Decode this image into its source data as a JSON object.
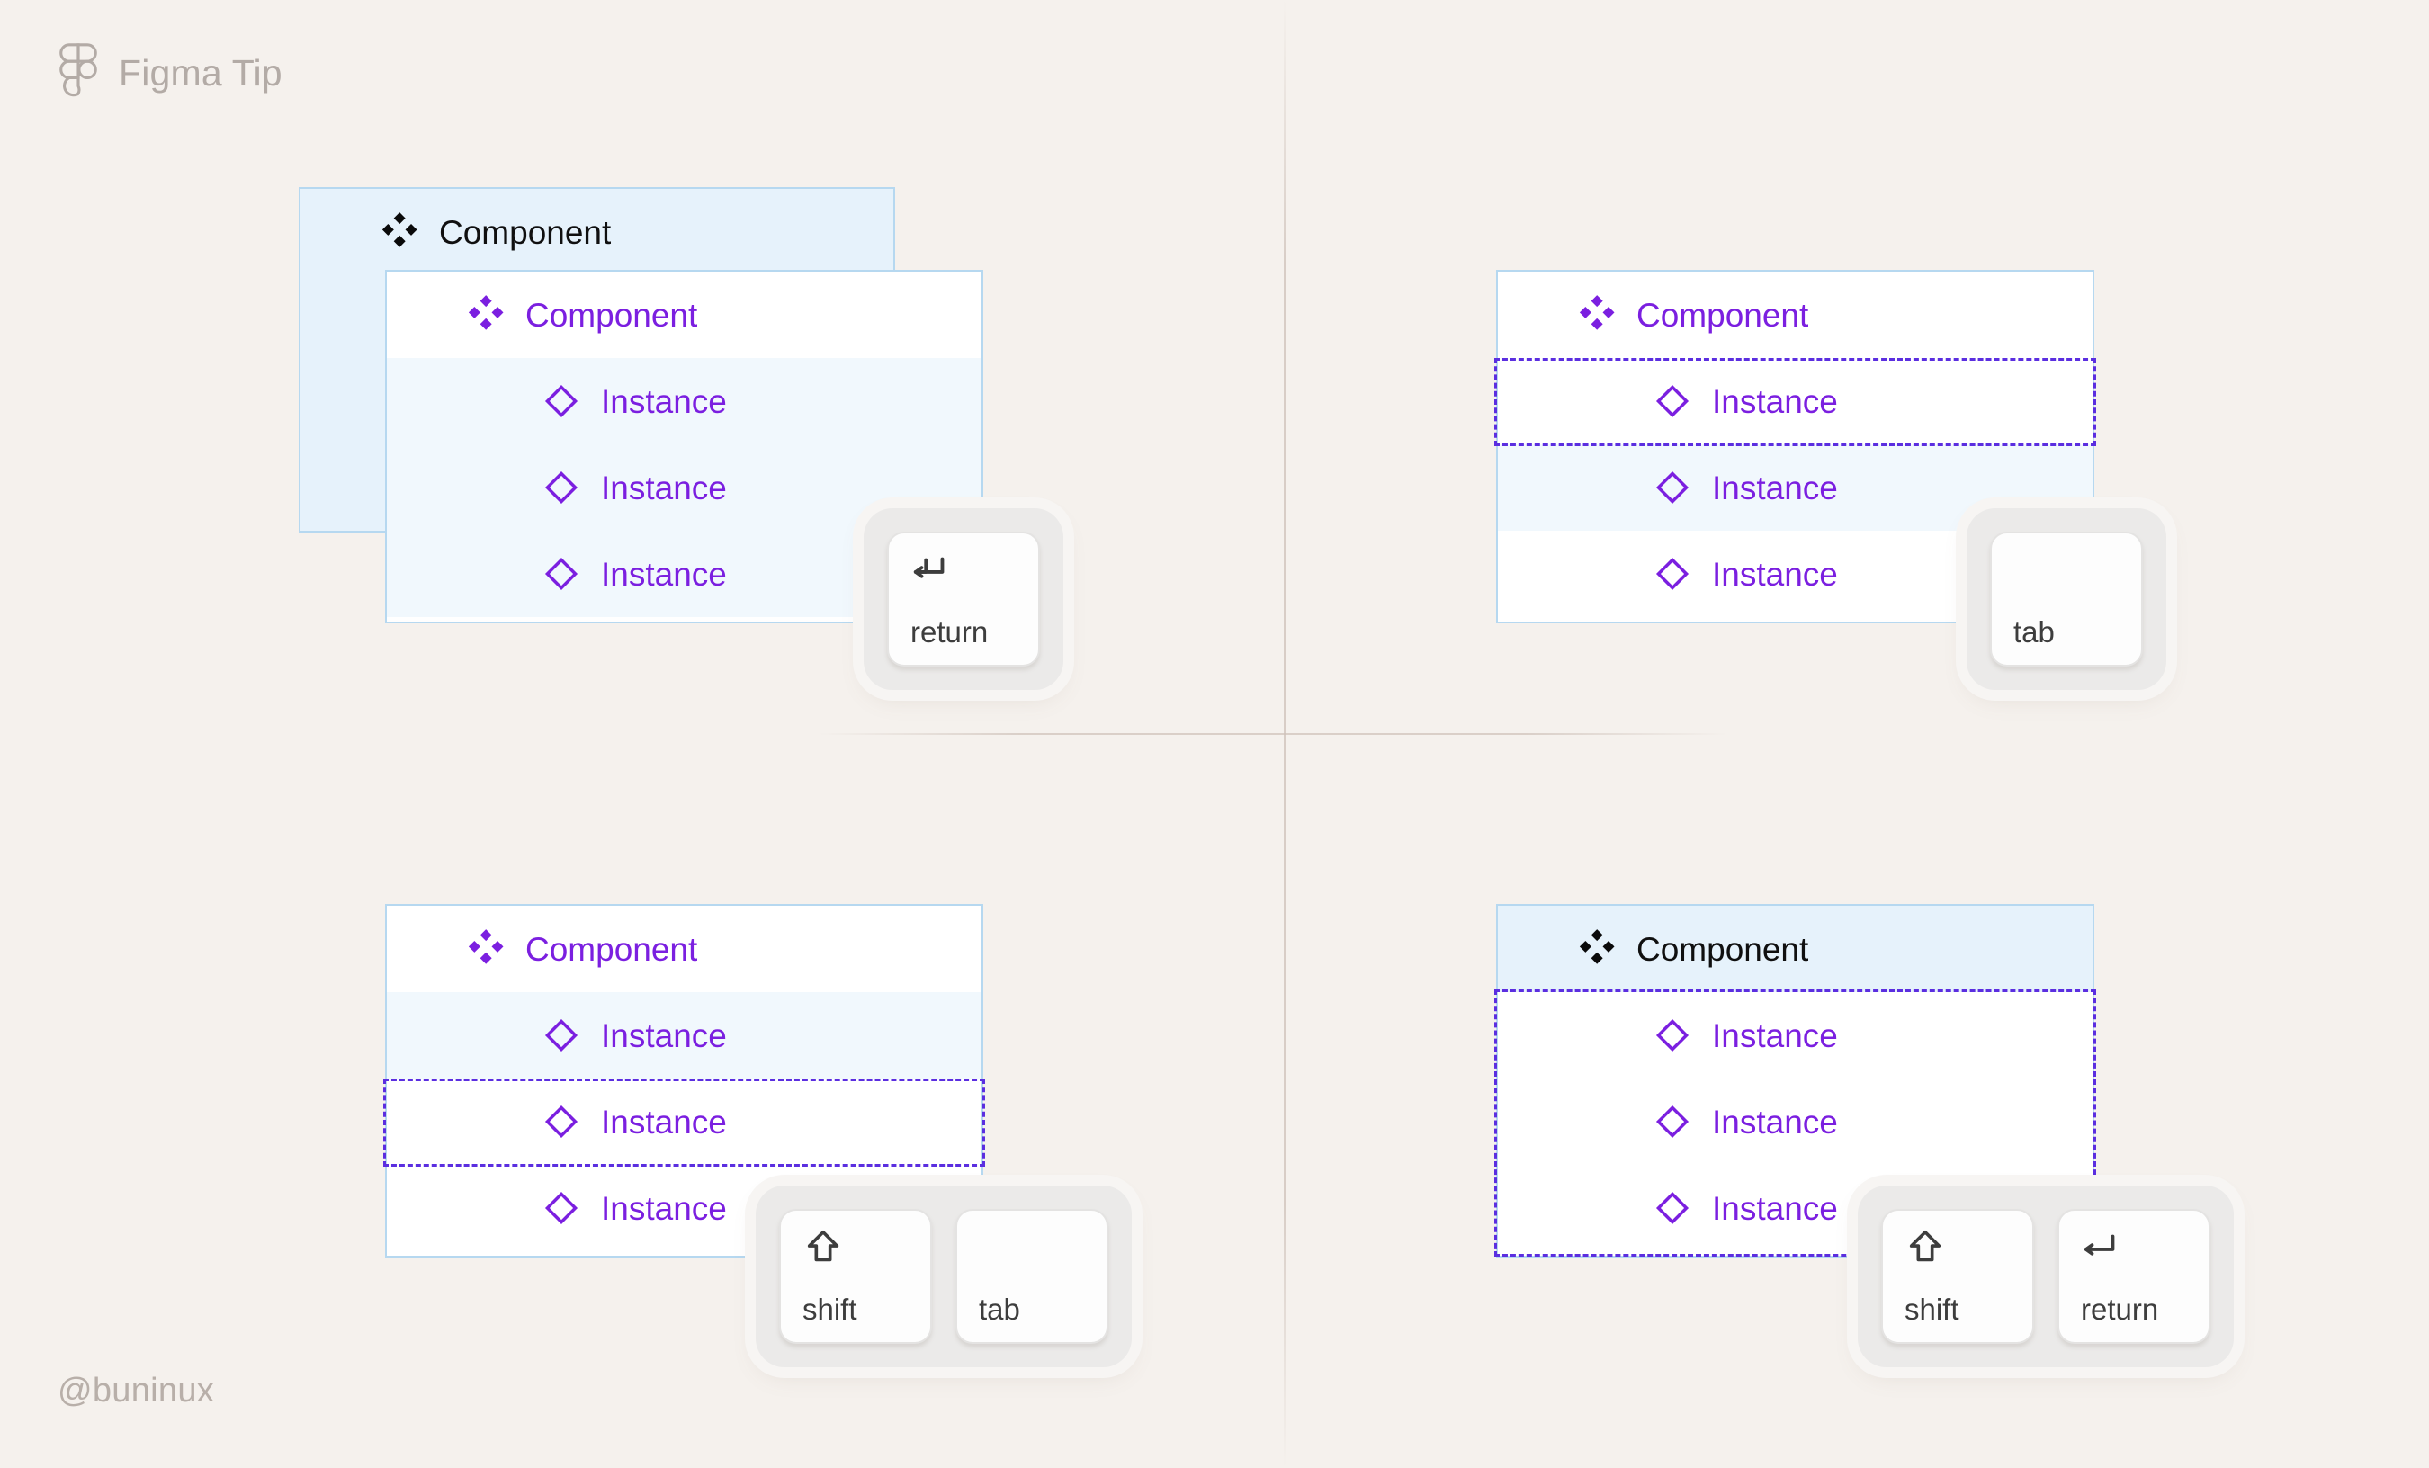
{
  "header": {
    "title": "Figma Tip",
    "logo_icon": "figma-logo-icon"
  },
  "watermark": "@buninux",
  "icons": {
    "component": "component-diamond-icon",
    "instance": "instance-diamond-outline-icon",
    "shift": "shift-arrow-up-icon",
    "return": "return-arrow-icon"
  },
  "colors": {
    "background": "#F5F1ED",
    "card_border": "#B6D8F0",
    "selection": "#5B2EE0",
    "purple_text": "#7B1FE0",
    "row_highlight": "#E6F2FB",
    "row_highlight_soft": "#F1F8FD",
    "header_text": "#B3ABA6"
  },
  "panels": [
    {
      "id": "top-left",
      "shortcut_label": "return",
      "ghost_card": {
        "label": "Component",
        "icon": "component-diamond-icon"
      },
      "rows": [
        {
          "label": "Component",
          "type": "component",
          "tone": "black",
          "fill": "white"
        },
        {
          "label": "Instance",
          "type": "instance",
          "tone": "purple",
          "fill": "lightblue"
        },
        {
          "label": "Instance",
          "type": "instance",
          "tone": "purple",
          "fill": "lightblue"
        },
        {
          "label": "Instance",
          "type": "instance",
          "tone": "purple",
          "fill": "lightblue"
        }
      ]
    },
    {
      "id": "top-right",
      "shortcut_label": "tab",
      "rows": [
        {
          "label": "Component",
          "type": "component",
          "tone": "purple",
          "fill": "white"
        },
        {
          "label": "Instance",
          "type": "instance",
          "tone": "purple",
          "fill": "white",
          "selected": true
        },
        {
          "label": "Instance",
          "type": "instance",
          "tone": "purple",
          "fill": "lightblue"
        },
        {
          "label": "Instance",
          "type": "instance",
          "tone": "purple",
          "fill": "white"
        }
      ]
    },
    {
      "id": "bottom-left",
      "shortcut_label": "shift + tab",
      "rows": [
        {
          "label": "Component",
          "type": "component",
          "tone": "purple",
          "fill": "white"
        },
        {
          "label": "Instance",
          "type": "instance",
          "tone": "purple",
          "fill": "lightblue"
        },
        {
          "label": "Instance",
          "type": "instance",
          "tone": "purple",
          "fill": "white",
          "selected": true
        },
        {
          "label": "Instance",
          "type": "instance",
          "tone": "purple",
          "fill": "white"
        }
      ]
    },
    {
      "id": "bottom-right",
      "shortcut_label": "shift + return",
      "rows": [
        {
          "label": "Component",
          "type": "component",
          "tone": "black",
          "fill": "blue"
        },
        {
          "label": "Instance",
          "type": "instance",
          "tone": "purple",
          "fill": "white"
        },
        {
          "label": "Instance",
          "type": "instance",
          "tone": "purple",
          "fill": "white"
        },
        {
          "label": "Instance",
          "type": "instance",
          "tone": "purple",
          "fill": "white"
        }
      ]
    }
  ],
  "keys": {
    "k_return_tl": {
      "label": "return",
      "glyph": "return-arrow-icon"
    },
    "k_tab_tr": {
      "label": "tab",
      "glyph": null
    },
    "k_shift_bl": {
      "label": "shift",
      "glyph": "shift-arrow-up-icon"
    },
    "k_tab_bl": {
      "label": "tab",
      "glyph": null
    },
    "k_shift_br": {
      "label": "shift",
      "glyph": "shift-arrow-up-icon"
    },
    "k_return_br": {
      "label": "return",
      "glyph": "return-arrow-icon"
    }
  }
}
